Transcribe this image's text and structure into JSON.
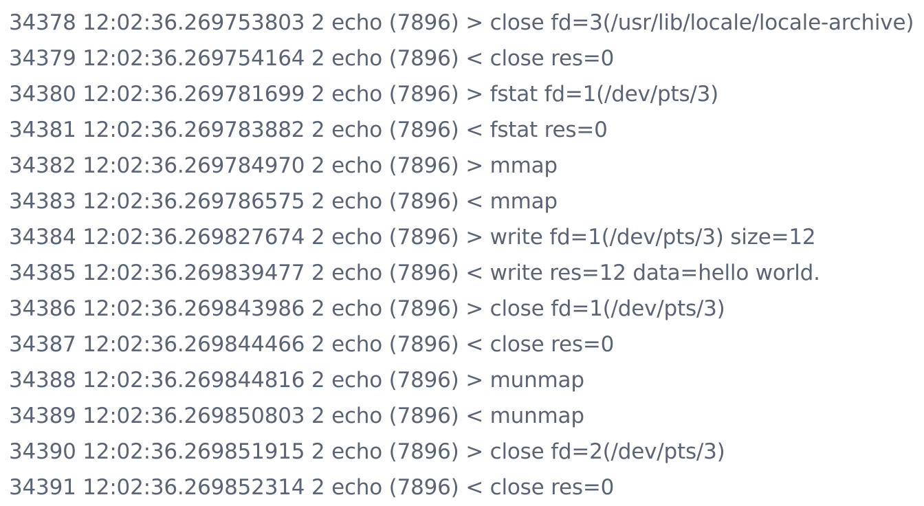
{
  "log": {
    "lines": [
      "34378 12:02:36.269753803 2 echo (7896) > close fd=3(/usr/lib/locale/locale-archive)",
      "34379 12:02:36.269754164 2 echo (7896) < close res=0",
      "34380 12:02:36.269781699 2 echo (7896) > fstat fd=1(/dev/pts/3)",
      "34381 12:02:36.269783882 2 echo (7896) < fstat res=0",
      "34382 12:02:36.269784970 2 echo (7896) > mmap",
      "34383 12:02:36.269786575 2 echo (7896) < mmap",
      "34384 12:02:36.269827674 2 echo (7896) > write fd=1(/dev/pts/3) size=12",
      "34385 12:02:36.269839477 2 echo (7896) < write res=12 data=hello world.",
      "34386 12:02:36.269843986 2 echo (7896) > close fd=1(/dev/pts/3)",
      "34387 12:02:36.269844466 2 echo (7896) < close res=0",
      "34388 12:02:36.269844816 2 echo (7896) > munmap",
      "34389 12:02:36.269850803 2 echo (7896) < munmap",
      "34390 12:02:36.269851915 2 echo (7896) > close fd=2(/dev/pts/3)",
      "34391 12:02:36.269852314 2 echo (7896) < close res=0"
    ]
  }
}
